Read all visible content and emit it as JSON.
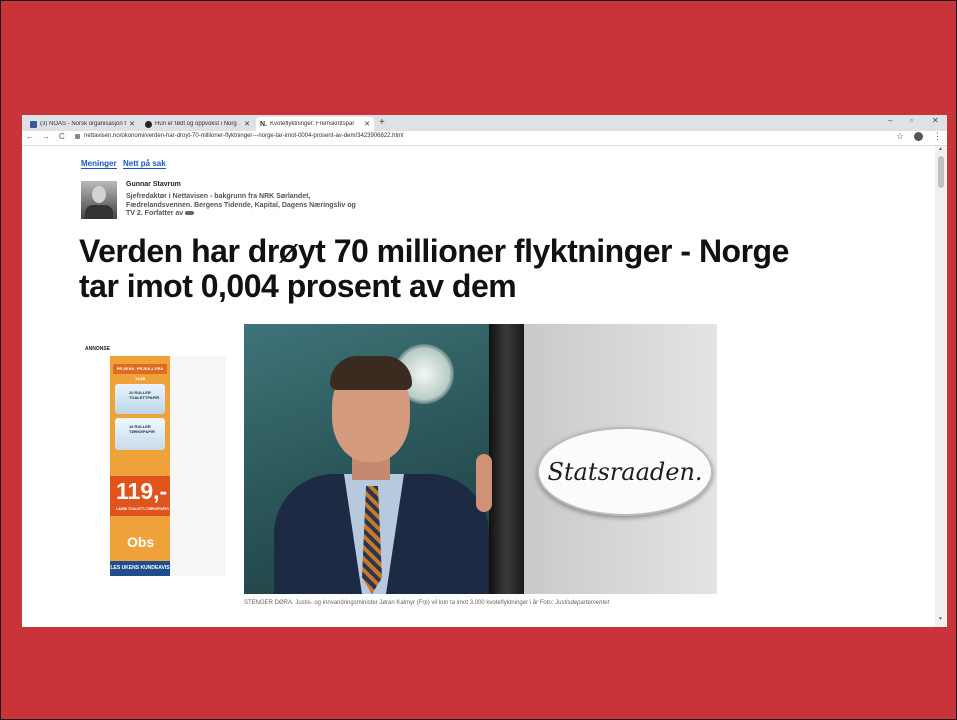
{
  "browser": {
    "tabs": [
      {
        "label": "(3) NOAS - Norsk organisasjon f",
        "favicon_color": "#3b5998",
        "active": false
      },
      {
        "label": "Hun er født og oppvokst i Norg",
        "favicon_color": "#222222",
        "active": false
      },
      {
        "label": "Kvoteflyktninger: Fremskrittspar",
        "favicon_color": "#ffffff",
        "favicon_text": "N.",
        "active": true
      }
    ],
    "new_tab": "+",
    "window_controls": {
      "minimize": "–",
      "restore": "▫",
      "close": "✕"
    },
    "nav": {
      "back": "←",
      "forward": "→",
      "reload": "C"
    },
    "url": "nettavisen.no/okonomi/verden-har-droyt-70-millioner-flyktninger---norge-tar-imot-0004-prosent-av-dem/3423906822.html",
    "star": "☆",
    "menu": "⋮"
  },
  "article": {
    "categories": [
      "Meninger",
      "Nett på sak"
    ],
    "author_name": "Gunnar Stavrum",
    "author_bio": "Sjefredaktør i Nettavisen - bakgrunn fra NRK Sørlandet, Fædrelandsvennen. Bergens Tidende, Kapital, Dagens Næringsliv og TV 2. Forfatter av",
    "headline": "Verden har drøyt 70 millioner flyktninger - Norge tar imot 0,004 prosent av dem",
    "ad_label": "ANNONSE",
    "ad": {
      "strip": "PR.SEKK. PR.RULL FRA 14,88",
      "product1": "20 RULLER TOALETTPAPIR",
      "product2": "16 RULLER TØRKEPAPIR",
      "price": "119,-",
      "price_sub": "LAMBI TOALETT-/TØRKEPAPIR",
      "brand": "Obs",
      "cta": "LES UKENS KUNDEAVIS"
    },
    "photo_sign": "Statsraaden.",
    "caption_main": "STENGER DØRA: Justis- og innvandringsminister Jøran Kalmyr (Frp) vil kun ta imot 3.000 kvoteflyktninger i år",
    "caption_credit": "Foto: Justisdepartementet"
  },
  "colors": {
    "slide_background": "#c8343a",
    "link": "#1a56c4",
    "ad_orange": "#f0a23a",
    "ad_price": "#e0531a",
    "ad_cta": "#1f4e8c"
  }
}
